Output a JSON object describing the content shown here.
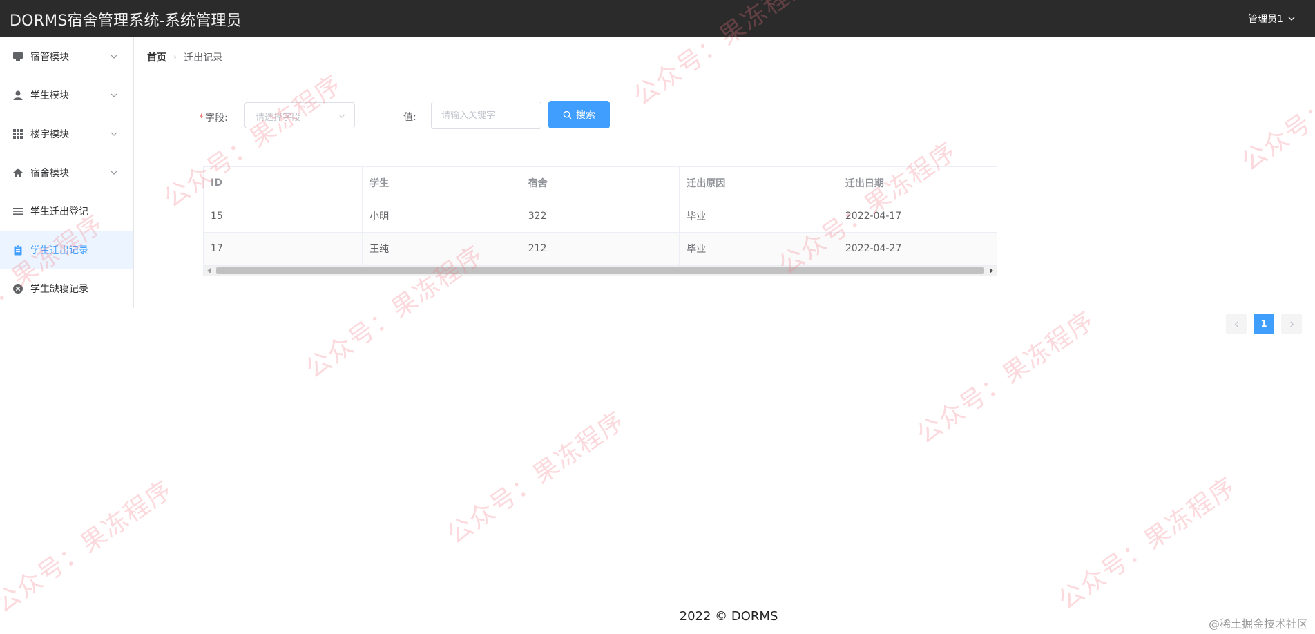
{
  "header": {
    "title": "DORMS宿舍管理系统-系统管理员",
    "user": "管理员1"
  },
  "sidebar": {
    "items": [
      {
        "label": "宿管模块",
        "icon": "monitor-icon",
        "expandable": true,
        "active": false
      },
      {
        "label": "学生模块",
        "icon": "user-icon",
        "expandable": true,
        "active": false
      },
      {
        "label": "楼宇模块",
        "icon": "grid-icon",
        "expandable": true,
        "active": false
      },
      {
        "label": "宿舍模块",
        "icon": "home-icon",
        "expandable": true,
        "active": false
      },
      {
        "label": "学生迁出登记",
        "icon": "list-icon",
        "expandable": false,
        "active": false
      },
      {
        "label": "学生迁出记录",
        "icon": "clipboard-icon",
        "expandable": false,
        "active": true
      },
      {
        "label": "学生缺寝记录",
        "icon": "circle-close-icon",
        "expandable": false,
        "active": false
      }
    ]
  },
  "breadcrumb": {
    "home": "首页",
    "separator": "›",
    "current": "迁出记录"
  },
  "search": {
    "field_label": "字段:",
    "field_required_mark": "*",
    "field_placeholder": "请选择字段",
    "value_label": "值:",
    "value_placeholder": "请输入关键字",
    "button_label": "搜索"
  },
  "table": {
    "columns": [
      "ID",
      "学生",
      "宿舍",
      "迁出原因",
      "迁出日期"
    ],
    "rows": [
      [
        "15",
        "小明",
        "322",
        "毕业",
        "2022-04-17"
      ],
      [
        "17",
        "王纯",
        "212",
        "毕业",
        "2022-04-27"
      ]
    ]
  },
  "pagination": {
    "current": "1"
  },
  "footer": {
    "text": "2022 © DORMS",
    "corner": "@稀土掘金技术社区"
  },
  "watermark": {
    "text": "公众号：果冻程序"
  },
  "colors": {
    "header_bg": "#2b2b2b",
    "primary": "#409eff",
    "active_menu_bg": "#ecf5ff",
    "required": "#f56c6c"
  }
}
